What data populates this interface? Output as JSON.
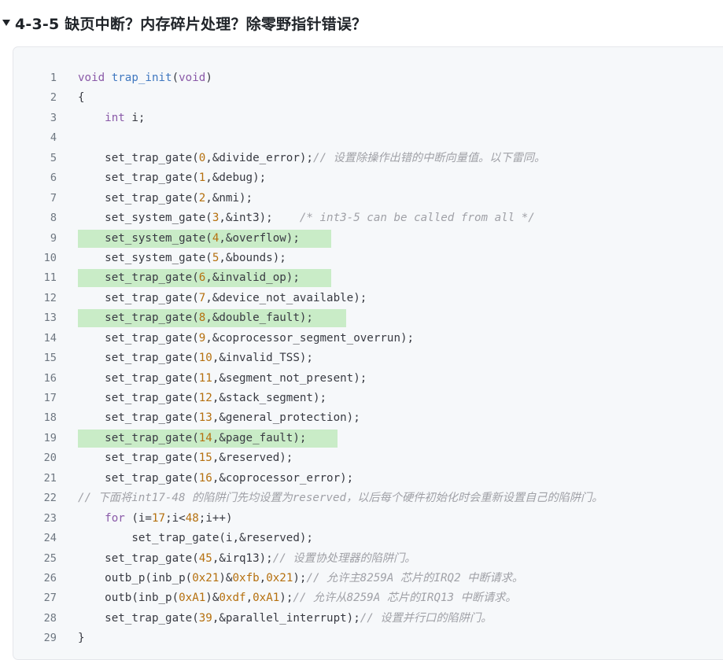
{
  "heading": {
    "toggle_icon": "triangle-down-icon",
    "text": "4-3-5 缺页中断？内存碎片处理？除零野指针错误？"
  },
  "code": {
    "lines": [
      {
        "n": "1",
        "hl": false,
        "tokens": [
          [
            "kw",
            "void"
          ],
          [
            "pl",
            " "
          ],
          [
            "fn",
            "trap_init"
          ],
          [
            "pl",
            "("
          ],
          [
            "kw",
            "void"
          ],
          [
            "pl",
            ")"
          ]
        ]
      },
      {
        "n": "2",
        "hl": false,
        "tokens": [
          [
            "pl",
            "{"
          ]
        ]
      },
      {
        "n": "3",
        "hl": false,
        "tokens": [
          [
            "pl",
            "    "
          ],
          [
            "kw",
            "int"
          ],
          [
            "pl",
            " i;"
          ]
        ]
      },
      {
        "n": "4",
        "hl": false,
        "tokens": []
      },
      {
        "n": "5",
        "hl": false,
        "tokens": [
          [
            "pl",
            "    set_trap_gate("
          ],
          [
            "num",
            "0"
          ],
          [
            "pl",
            ",&divide_error);"
          ],
          [
            "cm",
            "// 设置除操作出错的中断向量值。以下雷同。"
          ]
        ]
      },
      {
        "n": "6",
        "hl": false,
        "tokens": [
          [
            "pl",
            "    set_trap_gate("
          ],
          [
            "num",
            "1"
          ],
          [
            "pl",
            ",&debug);"
          ]
        ]
      },
      {
        "n": "7",
        "hl": false,
        "tokens": [
          [
            "pl",
            "    set_trap_gate("
          ],
          [
            "num",
            "2"
          ],
          [
            "pl",
            ",&nmi);"
          ]
        ]
      },
      {
        "n": "8",
        "hl": false,
        "tokens": [
          [
            "pl",
            "    set_system_gate("
          ],
          [
            "num",
            "3"
          ],
          [
            "pl",
            ",&int3);    "
          ],
          [
            "cm",
            "/* int3-5 can be called from all */"
          ]
        ]
      },
      {
        "n": "9",
        "hl": true,
        "hlw": "322px",
        "tokens": [
          [
            "pl",
            "    set_system_gate("
          ],
          [
            "num",
            "4"
          ],
          [
            "pl",
            ",&overflow);"
          ]
        ]
      },
      {
        "n": "10",
        "hl": false,
        "tokens": [
          [
            "pl",
            "    set_system_gate("
          ],
          [
            "num",
            "5"
          ],
          [
            "pl",
            ",&bounds);"
          ]
        ]
      },
      {
        "n": "11",
        "hl": true,
        "hlw": "322px",
        "tokens": [
          [
            "pl",
            "    set_trap_gate("
          ],
          [
            "num",
            "6"
          ],
          [
            "pl",
            ",&invalid_op);"
          ]
        ]
      },
      {
        "n": "12",
        "hl": false,
        "tokens": [
          [
            "pl",
            "    set_trap_gate("
          ],
          [
            "num",
            "7"
          ],
          [
            "pl",
            ",&device_not_available);"
          ]
        ]
      },
      {
        "n": "13",
        "hl": true,
        "hlw": "341px",
        "tokens": [
          [
            "pl",
            "    set_trap_gate("
          ],
          [
            "num",
            "8"
          ],
          [
            "pl",
            ",&double_fault);"
          ]
        ]
      },
      {
        "n": "14",
        "hl": false,
        "tokens": [
          [
            "pl",
            "    set_trap_gate("
          ],
          [
            "num",
            "9"
          ],
          [
            "pl",
            ",&coprocessor_segment_overrun);"
          ]
        ]
      },
      {
        "n": "15",
        "hl": false,
        "tokens": [
          [
            "pl",
            "    set_trap_gate("
          ],
          [
            "num",
            "10"
          ],
          [
            "pl",
            ",&invalid_TSS);"
          ]
        ]
      },
      {
        "n": "16",
        "hl": false,
        "tokens": [
          [
            "pl",
            "    set_trap_gate("
          ],
          [
            "num",
            "11"
          ],
          [
            "pl",
            ",&segment_not_present);"
          ]
        ]
      },
      {
        "n": "17",
        "hl": false,
        "tokens": [
          [
            "pl",
            "    set_trap_gate("
          ],
          [
            "num",
            "12"
          ],
          [
            "pl",
            ",&stack_segment);"
          ]
        ]
      },
      {
        "n": "18",
        "hl": false,
        "tokens": [
          [
            "pl",
            "    set_trap_gate("
          ],
          [
            "num",
            "13"
          ],
          [
            "pl",
            ",&general_protection);"
          ]
        ]
      },
      {
        "n": "19",
        "hl": true,
        "hlw": "330px",
        "tokens": [
          [
            "pl",
            "    set_trap_gate("
          ],
          [
            "num",
            "14"
          ],
          [
            "pl",
            ",&page_fault);"
          ]
        ]
      },
      {
        "n": "20",
        "hl": false,
        "tokens": [
          [
            "pl",
            "    set_trap_gate("
          ],
          [
            "num",
            "15"
          ],
          [
            "pl",
            ",&reserved);"
          ]
        ]
      },
      {
        "n": "21",
        "hl": false,
        "tokens": [
          [
            "pl",
            "    set_trap_gate("
          ],
          [
            "num",
            "16"
          ],
          [
            "pl",
            ",&coprocessor_error);"
          ]
        ]
      },
      {
        "n": "22",
        "hl": false,
        "tokens": [
          [
            "cm",
            "// 下面将int17-48 的陷阱门先均设置为reserved，以后每个硬件初始化时会重新设置自己的陷阱门。"
          ]
        ]
      },
      {
        "n": "23",
        "hl": false,
        "tokens": [
          [
            "pl",
            "    "
          ],
          [
            "kw",
            "for"
          ],
          [
            "pl",
            " (i="
          ],
          [
            "num",
            "17"
          ],
          [
            "pl",
            ";i<"
          ],
          [
            "num",
            "48"
          ],
          [
            "pl",
            ";i++)"
          ]
        ]
      },
      {
        "n": "24",
        "hl": false,
        "tokens": [
          [
            "pl",
            "        set_trap_gate(i,&reserved);"
          ]
        ]
      },
      {
        "n": "25",
        "hl": false,
        "tokens": [
          [
            "pl",
            "    set_trap_gate("
          ],
          [
            "num",
            "45"
          ],
          [
            "pl",
            ",&irq13);"
          ],
          [
            "cm",
            "// 设置协处理器的陷阱门。"
          ]
        ]
      },
      {
        "n": "26",
        "hl": false,
        "tokens": [
          [
            "pl",
            "    outb_p(inb_p("
          ],
          [
            "num",
            "0x21"
          ],
          [
            "pl",
            ")&"
          ],
          [
            "num",
            "0xfb"
          ],
          [
            "pl",
            ","
          ],
          [
            "num",
            "0x21"
          ],
          [
            "pl",
            ");"
          ],
          [
            "cm",
            "// 允许主8259A 芯片的IRQ2 中断请求。"
          ]
        ]
      },
      {
        "n": "27",
        "hl": false,
        "tokens": [
          [
            "pl",
            "    outb(inb_p("
          ],
          [
            "num",
            "0xA1"
          ],
          [
            "pl",
            ")&"
          ],
          [
            "num",
            "0xdf"
          ],
          [
            "pl",
            ","
          ],
          [
            "num",
            "0xA1"
          ],
          [
            "pl",
            ");"
          ],
          [
            "cm",
            "// 允许从8259A 芯片的IRQ13 中断请求。"
          ]
        ]
      },
      {
        "n": "28",
        "hl": false,
        "tokens": [
          [
            "pl",
            "    set_trap_gate("
          ],
          [
            "num",
            "39"
          ],
          [
            "pl",
            ",&parallel_interrupt);"
          ],
          [
            "cm",
            "// 设置并行口的陷阱门。"
          ]
        ]
      },
      {
        "n": "29",
        "hl": false,
        "tokens": [
          [
            "pl",
            "}"
          ]
        ]
      }
    ]
  }
}
